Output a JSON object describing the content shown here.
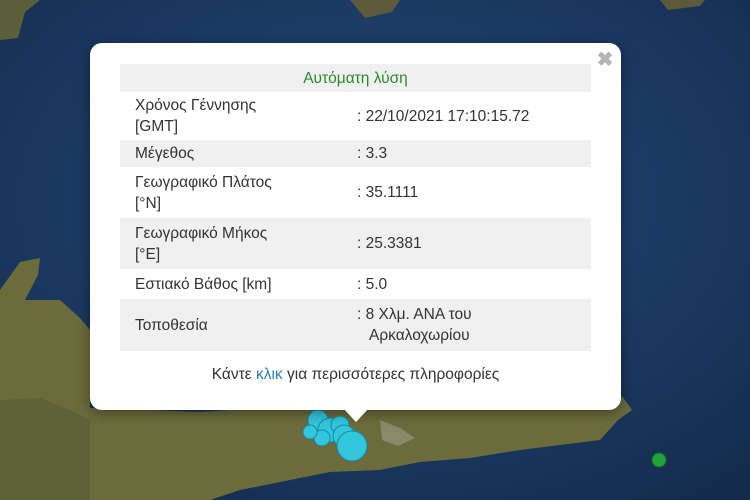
{
  "popup": {
    "title": "Αυτόματη λύση",
    "close_symbol": "✖",
    "rows": [
      {
        "label_line1": "Χρόνος Γέννησης",
        "label_line2": "[GMT]",
        "value_line1": ": 22/10/2021 17:10:15.72",
        "value_line2": ""
      },
      {
        "label_line1": "Μέγεθος",
        "label_line2": "",
        "value_line1": ": 3.3",
        "value_line2": ""
      },
      {
        "label_line1": "Γεωγραφικό Πλάτος",
        "label_line2": "[°N]",
        "value_line1": ": 35.1111",
        "value_line2": ""
      },
      {
        "label_line1": "Γεωγραφικό Μήκος",
        "label_line2": "[°E]",
        "value_line1": ": 25.3381",
        "value_line2": ""
      },
      {
        "label_line1": "Εστιακό Βάθος [km]",
        "label_line2": "",
        "value_line1": ": 5.0",
        "value_line2": ""
      },
      {
        "label_line1": "Τοποθεσία",
        "label_line2": "",
        "value_line1": ": 8 Χλμ. ΑΝΑ του",
        "value_line2": "Αρκαλοχωρίου"
      }
    ],
    "more_before": "Κάντε",
    "more_link": "κλικ",
    "more_after": "για περισσότερες πληροφορίες"
  },
  "colors": {
    "sea": "#1c3a63",
    "land": "#6b6b3c",
    "quake_marker": "#33c6dd",
    "other_marker": "#1fa33a",
    "title_green": "#2c8a2c",
    "link_blue": "#2a7fb5"
  },
  "icons": [
    "close-icon",
    "earthquake-marker-icon"
  ]
}
